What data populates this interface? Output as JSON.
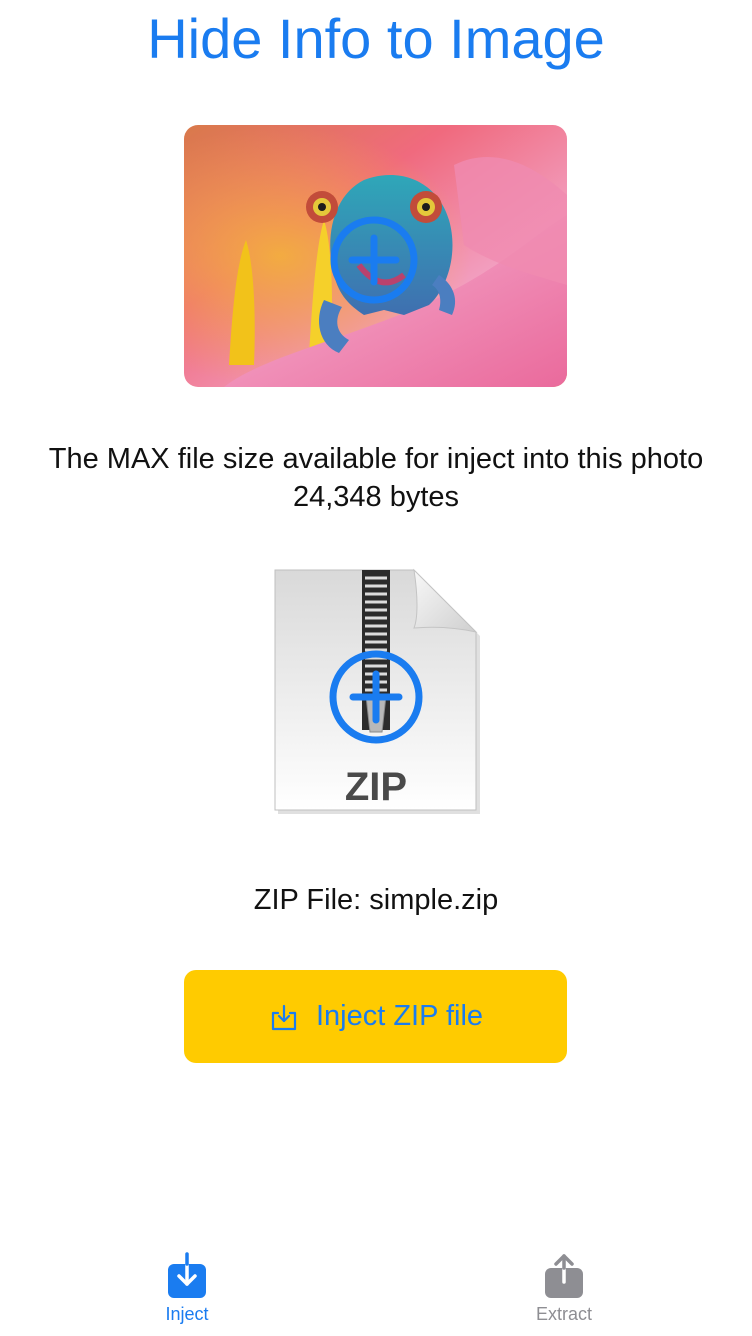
{
  "header": {
    "title": "Hide Info to Image"
  },
  "photo": {
    "add_icon": "plus-circle-icon",
    "accent_color": "#1a7cf0"
  },
  "capacity": {
    "label": "The MAX file size available for inject into this photo",
    "value": "24,348 bytes"
  },
  "zip": {
    "icon_text": "ZIP",
    "add_icon": "plus-circle-icon",
    "file_label": "ZIP File: simple.zip"
  },
  "inject_button": {
    "label": "Inject ZIP file",
    "icon": "tray-download-icon",
    "background": "#ffcb00",
    "text_color": "#1a7cf0"
  },
  "tabbar": {
    "tabs": [
      {
        "label": "Inject",
        "icon": "tray-download-icon",
        "active": true,
        "color": "#1a7cf0"
      },
      {
        "label": "Extract",
        "icon": "share-upload-icon",
        "active": false,
        "color": "#8e8e93"
      }
    ]
  }
}
